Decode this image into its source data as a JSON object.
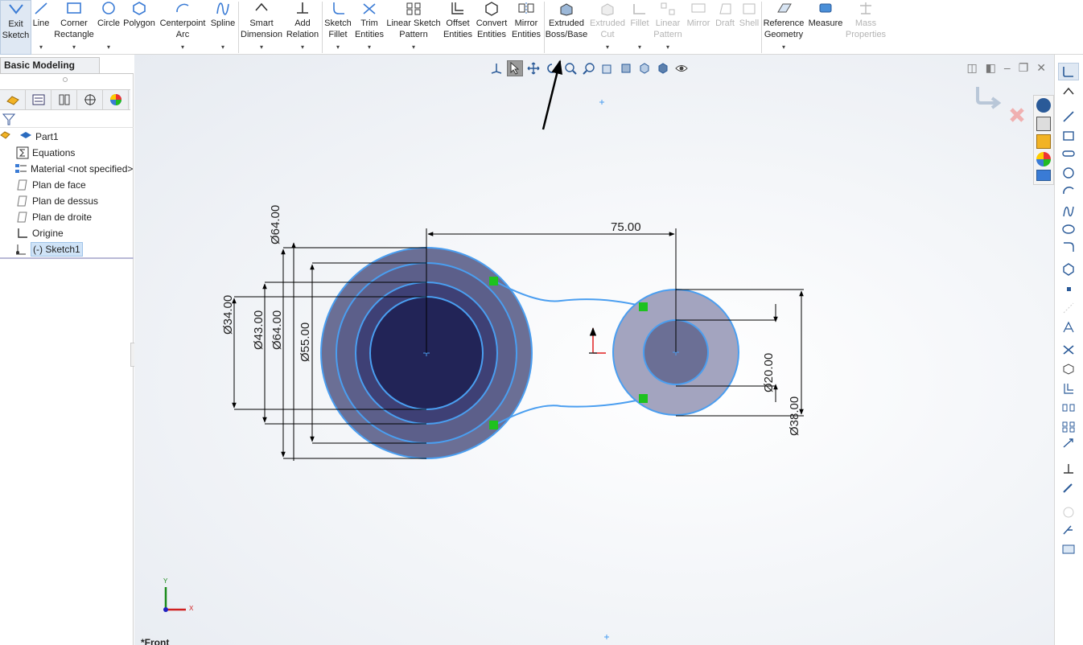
{
  "ribbon": {
    "exit_sketch": "Exit\nSketch",
    "line": "Line",
    "corner_rectangle": "Corner\nRectangle",
    "circle": "Circle",
    "polygon": "Polygon",
    "centerpoint_arc": "Centerpoint\nArc",
    "spline": "Spline",
    "smart_dimension": "Smart\nDimension",
    "add_relation": "Add\nRelation",
    "sketch_fillet": "Sketch\nFillet",
    "trim_entities": "Trim\nEntities",
    "linear_sketch_pattern": "Linear Sketch\nPattern",
    "offset_entities": "Offset\nEntities",
    "convert_entities": "Convert\nEntities",
    "mirror_entities": "Mirror\nEntities",
    "extruded_boss": "Extruded\nBoss/Base",
    "extruded_cut": "Extruded\nCut",
    "fillet": "Fillet",
    "linear_pattern": "Linear\nPattern",
    "mirror": "Mirror",
    "draft": "Draft",
    "shell": "Shell",
    "reference_geometry": "Reference\nGeometry",
    "measure": "Measure",
    "mass_properties": "Mass\nProperties"
  },
  "command_tab": "Basic Modeling Tools",
  "tree": {
    "part": "Part1",
    "equations": "Equations",
    "material": "Material <not specified>",
    "front_plane": "Plan de face",
    "top_plane": "Plan de dessus",
    "right_plane": "Plan de droite",
    "origin": "Origine",
    "sketch": "(-) Sketch1"
  },
  "dimensions": {
    "center_distance": "75.00",
    "d64_top": "Ø64.00",
    "d34": "Ø34.00",
    "d43": "Ø43.00",
    "d64": "Ø64.00",
    "d55": "Ø55.00",
    "d20": "Ø20.00",
    "d38": "Ø38.00"
  },
  "triad": {
    "y": "Y",
    "x": "X"
  },
  "view_label": "*Front",
  "colors": {
    "sketch_blue": "#4a9ef0",
    "fill_outer": "#6b6f95",
    "fill_inner": "#222457",
    "relation_green": "#1ec21e"
  }
}
